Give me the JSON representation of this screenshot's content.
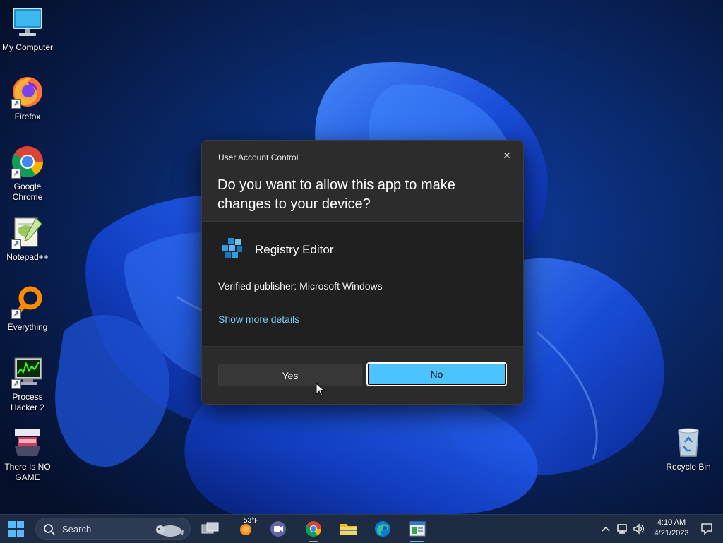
{
  "desktop": {
    "icons": [
      {
        "label": "My Computer",
        "icon": "monitor-icon"
      },
      {
        "label": "Firefox",
        "icon": "firefox-icon"
      },
      {
        "label": "Google Chrome",
        "icon": "chrome-icon"
      },
      {
        "label": "Notepad++",
        "icon": "notepadpp-icon"
      },
      {
        "label": "Everything",
        "icon": "search-magnifier-icon"
      },
      {
        "label": "Process Hacker 2",
        "icon": "process-hacker-icon"
      },
      {
        "label": "There Is NO GAME",
        "icon": "game-logo-icon"
      },
      {
        "label": "Recycle Bin",
        "icon": "recycle-bin-icon"
      }
    ]
  },
  "uac": {
    "caption": "User Account Control",
    "close_glyph": "✕",
    "question": "Do you want to allow this app to make changes to your device?",
    "app_name": "Registry Editor",
    "publisher": "Verified publisher: Microsoft Windows",
    "details_link": "Show more details",
    "yes_label": "Yes",
    "no_label": "No",
    "accent_color": "#4cc2ff"
  },
  "taskbar": {
    "search_label": "Search",
    "weather": "53°F",
    "time": "4:10 AM",
    "date": "4/21/2023",
    "pinned": [
      "task-view-icon",
      "weather-icon",
      "teams-chat-icon",
      "chrome-icon",
      "file-explorer-icon",
      "edge-icon",
      "registry-app-icon"
    ]
  }
}
